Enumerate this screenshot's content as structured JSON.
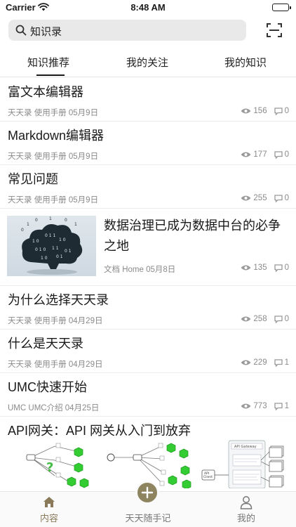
{
  "status_bar": {
    "carrier": "Carrier",
    "time": "8:48 AM"
  },
  "search": {
    "text": "知识录"
  },
  "tabs": [
    {
      "label": "知识推荐",
      "active": true
    },
    {
      "label": "我的关注",
      "active": false
    },
    {
      "label": "我的知识",
      "active": false
    }
  ],
  "feed": [
    {
      "title": "富文本编辑器",
      "meta": "天天录 使用手册 05月9日",
      "views": "156",
      "comments": "0"
    },
    {
      "title": "Markdown编辑器",
      "meta": "天天录 使用手册 05月9日",
      "views": "177",
      "comments": "0"
    },
    {
      "title": "常见问题",
      "meta": "天天录 使用手册 05月9日",
      "views": "255",
      "comments": "0"
    },
    {
      "title": "数据治理已成为数据中台的必争之地",
      "meta": "文档 Home 05月8日",
      "views": "135",
      "comments": "0"
    },
    {
      "title": "为什么选择天天录",
      "meta": "天天录 使用手册 04月29日",
      "views": "258",
      "comments": "0"
    },
    {
      "title": "什么是天天录",
      "meta": "天天录 使用手册 04月29日",
      "views": "229",
      "comments": "1"
    },
    {
      "title": "UMC快速开始",
      "meta": "UMC UMC介绍 04月25日",
      "views": "773",
      "comments": "1"
    },
    {
      "title": "API网关：API 网关从入门到放弃"
    }
  ],
  "bottom_nav": [
    {
      "label": "内容",
      "icon": "home-icon",
      "active": true
    },
    {
      "label": "天天随手记",
      "icon": "plus-icon",
      "active": false
    },
    {
      "label": "我的",
      "icon": "person-icon",
      "active": false
    }
  ],
  "colors": {
    "accent": "#8e8460",
    "text": "#1a1a1a",
    "muted": "#8a8a8a",
    "search_bg": "#e9e9e9"
  }
}
